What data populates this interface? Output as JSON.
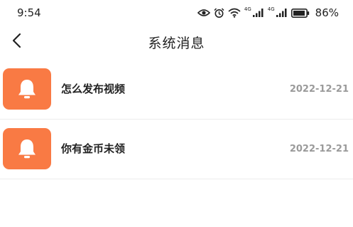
{
  "status_bar": {
    "time": "9:54",
    "network_tag_1": "4G",
    "network_tag_2": "4G",
    "battery": "86%",
    "icons": [
      "eye-icon",
      "alarm-icon",
      "wifi-icon",
      "signal-icon",
      "signal-icon",
      "battery-icon"
    ]
  },
  "header": {
    "title": "系统消息",
    "back_icon": "chevron-left-icon"
  },
  "messages": [
    {
      "title": "怎么发布视频",
      "date": "2022-12-21",
      "icon": "bell-icon"
    },
    {
      "title": "你有金币未领",
      "date": "2022-12-21",
      "icon": "bell-icon"
    }
  ],
  "colors": {
    "accent": "#f97a44",
    "date_text": "#9a9a9a",
    "divider": "#ececec"
  }
}
